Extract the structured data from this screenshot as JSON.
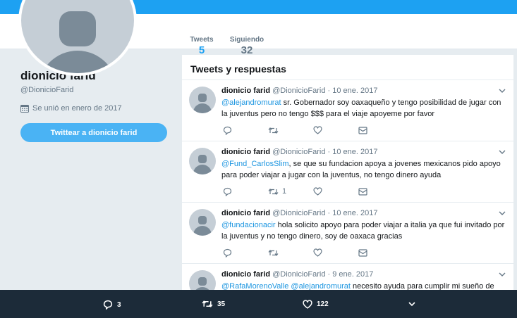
{
  "profile": {
    "name": "dionicio farid",
    "handle": "@DionicioFarid",
    "joined": "Se unió en enero de 2017",
    "tweet_to_label": "Twittear a dionicio farid"
  },
  "stats": {
    "tweets_label": "Tweets",
    "tweets_count": "5",
    "following_label": "Siguiendo",
    "following_count": "32"
  },
  "timeline": {
    "title": "Tweets y respuestas",
    "tweets": [
      {
        "name": "dionicio farid",
        "meta": "@DionicioFarid · 10 ene. 2017",
        "mentions": "@alejandromurat",
        "text": " sr. Gobernador soy oaxaqueño y tengo posibilidad de jugar con la juventus pero no tengo $$$ para el viaje apoyeme por favor",
        "retweets": ""
      },
      {
        "name": "dionicio farid",
        "meta": "@DionicioFarid · 10 ene. 2017",
        "mentions": "@Fund_CarlosSlim",
        "text": ", se que su fundacion apoya a jovenes mexicanos pido apoyo para poder viajar a jugar con la juventus, no tengo dinero ayuda",
        "retweets": "1"
      },
      {
        "name": "dionicio farid",
        "meta": "@DionicioFarid · 10 ene. 2017",
        "mentions": "@fundacionacir",
        "text": " hola solicito apoyo para poder viajar a italia ya que fui invitado por la juventus y no tengo dinero, soy de oaxaca gracias",
        "retweets": ""
      },
      {
        "name": "dionicio farid",
        "meta": "@DionicioFarid · 9 ene. 2017",
        "mentions": "@RafaMorenoValle @alejandromurat",
        "text": " necesito ayuda para cumplir mi sueño de",
        "retweets": ""
      }
    ]
  },
  "footer": {
    "replies": "3",
    "retweets": "35",
    "likes": "122"
  },
  "colors": {
    "brand": "#1da1f2",
    "footer_bg": "#1c2b39",
    "page_bg": "#e6ecf0"
  }
}
